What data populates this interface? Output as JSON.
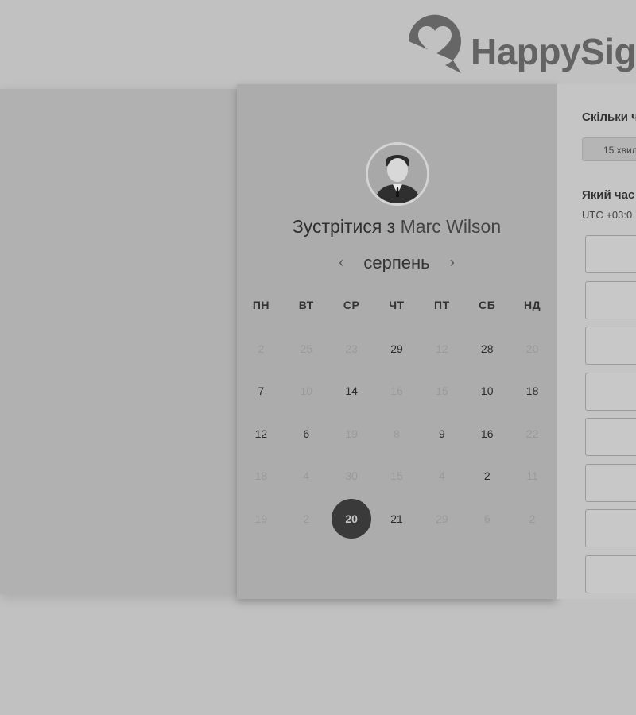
{
  "brand": {
    "name": "HappySig"
  },
  "meeting": {
    "title_prefix": "Зустрітися з",
    "host_name": "Marc Wilson"
  },
  "calendar": {
    "month": "серпень",
    "prev_icon": "chevron-left-icon",
    "next_icon": "chevron-right-icon",
    "weekdays": [
      "ПН",
      "ВТ",
      "СР",
      "ЧТ",
      "ПТ",
      "СБ",
      "НД"
    ],
    "days": [
      {
        "label": "2",
        "available": false
      },
      {
        "label": "25",
        "available": false
      },
      {
        "label": "23",
        "available": false
      },
      {
        "label": "29",
        "available": true
      },
      {
        "label": "12",
        "available": false
      },
      {
        "label": "28",
        "available": true
      },
      {
        "label": "20",
        "available": false
      },
      {
        "label": "7",
        "available": true
      },
      {
        "label": "10",
        "available": false
      },
      {
        "label": "14",
        "available": true
      },
      {
        "label": "16",
        "available": false
      },
      {
        "label": "15",
        "available": false
      },
      {
        "label": "10",
        "available": true
      },
      {
        "label": "18",
        "available": true
      },
      {
        "label": "12",
        "available": true
      },
      {
        "label": "6",
        "available": true
      },
      {
        "label": "19",
        "available": false
      },
      {
        "label": "8",
        "available": false
      },
      {
        "label": "9",
        "available": true
      },
      {
        "label": "16",
        "available": true
      },
      {
        "label": "22",
        "available": false
      },
      {
        "label": "18",
        "available": false
      },
      {
        "label": "4",
        "available": false
      },
      {
        "label": "30",
        "available": false
      },
      {
        "label": "15",
        "available": false
      },
      {
        "label": "4",
        "available": false
      },
      {
        "label": "2",
        "available": true
      },
      {
        "label": "11",
        "available": false
      },
      {
        "label": "19",
        "available": false
      },
      {
        "label": "2",
        "available": false
      },
      {
        "label": "20",
        "available": true,
        "selected": true
      },
      {
        "label": "21",
        "available": true
      },
      {
        "label": "29",
        "available": false
      },
      {
        "label": "6",
        "available": false
      },
      {
        "label": "2",
        "available": false
      }
    ]
  },
  "booking": {
    "duration_question": "Скільки ч",
    "duration_value": "15 хвил",
    "time_question": "Який час",
    "timezone": "UTC +03:0",
    "slot_count": 8
  },
  "colors": {
    "selected_day": "#3a3a3a",
    "available_day": "#2c2c2c",
    "unavailable_day": "#9a9a9a"
  }
}
